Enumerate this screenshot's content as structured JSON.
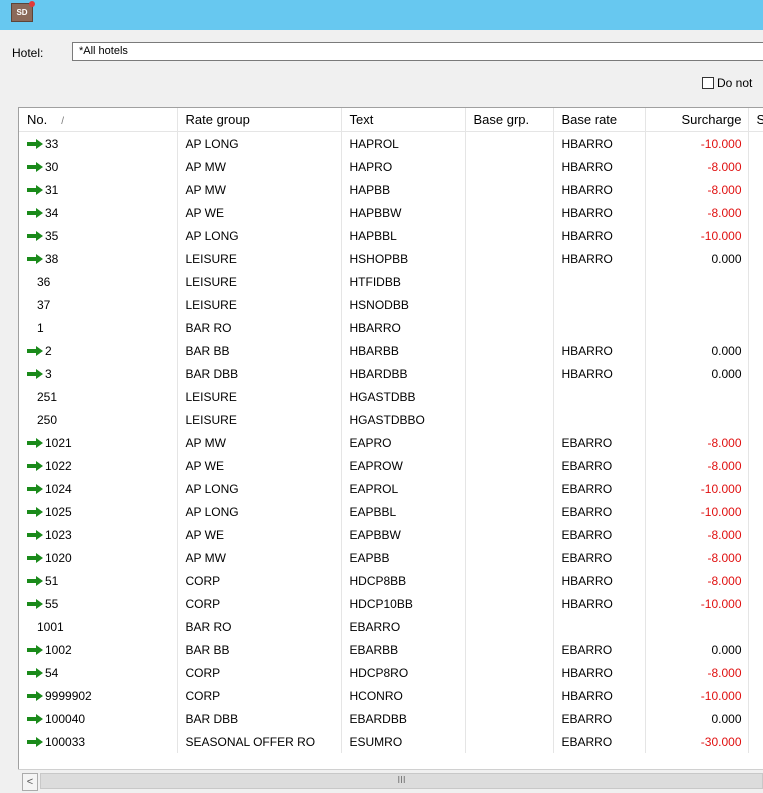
{
  "window": {
    "icon_text": "SD"
  },
  "filter": {
    "hotel_label": "Hotel:",
    "hotel_value": "*All hotels",
    "donot_label": "Do not"
  },
  "columns": [
    "No.",
    "Rate group",
    "Text",
    "Base grp.",
    "Base rate",
    "Surcharge",
    "Su"
  ],
  "rows": [
    {
      "arrow": true,
      "no": "33",
      "rate_group": "AP LONG",
      "text": "HAPROL",
      "base_grp": "",
      "base_rate": "HBARRO",
      "surcharge": "-10.000"
    },
    {
      "arrow": true,
      "no": "30",
      "rate_group": "AP MW",
      "text": "HAPRO",
      "base_grp": "",
      "base_rate": "HBARRO",
      "surcharge": "-8.000"
    },
    {
      "arrow": true,
      "no": "31",
      "rate_group": "AP MW",
      "text": "HAPBB",
      "base_grp": "",
      "base_rate": "HBARRO",
      "surcharge": "-8.000"
    },
    {
      "arrow": true,
      "no": "34",
      "rate_group": "AP WE",
      "text": "HAPBBW",
      "base_grp": "",
      "base_rate": "HBARRO",
      "surcharge": "-8.000"
    },
    {
      "arrow": true,
      "no": "35",
      "rate_group": "AP LONG",
      "text": "HAPBBL",
      "base_grp": "",
      "base_rate": "HBARRO",
      "surcharge": "-10.000"
    },
    {
      "arrow": true,
      "no": "38",
      "rate_group": "LEISURE",
      "text": "HSHOPBB",
      "base_grp": "",
      "base_rate": "HBARRO",
      "surcharge": "0.000"
    },
    {
      "arrow": false,
      "no": "36",
      "rate_group": "LEISURE",
      "text": "HTFIDBB",
      "base_grp": "",
      "base_rate": "",
      "surcharge": ""
    },
    {
      "arrow": false,
      "no": "37",
      "rate_group": "LEISURE",
      "text": "HSNODBB",
      "base_grp": "",
      "base_rate": "",
      "surcharge": ""
    },
    {
      "arrow": false,
      "no": "1",
      "rate_group": "BAR RO",
      "text": "HBARRO",
      "base_grp": "",
      "base_rate": "",
      "surcharge": ""
    },
    {
      "arrow": true,
      "no": "2",
      "rate_group": "BAR BB",
      "text": "HBARBB",
      "base_grp": "",
      "base_rate": "HBARRO",
      "surcharge": "0.000"
    },
    {
      "arrow": true,
      "no": "3",
      "rate_group": "BAR DBB",
      "text": "HBARDBB",
      "base_grp": "",
      "base_rate": "HBARRO",
      "surcharge": "0.000"
    },
    {
      "arrow": false,
      "no": "251",
      "rate_group": "LEISURE",
      "text": "HGASTDBB",
      "base_grp": "",
      "base_rate": "",
      "surcharge": ""
    },
    {
      "arrow": false,
      "no": "250",
      "rate_group": "LEISURE",
      "text": "HGASTDBBO",
      "base_grp": "",
      "base_rate": "",
      "surcharge": ""
    },
    {
      "arrow": true,
      "no": "1021",
      "rate_group": "AP MW",
      "text": "EAPRO",
      "base_grp": "",
      "base_rate": "EBARRO",
      "surcharge": "-8.000"
    },
    {
      "arrow": true,
      "no": "1022",
      "rate_group": "AP WE",
      "text": "EAPROW",
      "base_grp": "",
      "base_rate": "EBARRO",
      "surcharge": "-8.000"
    },
    {
      "arrow": true,
      "no": "1024",
      "rate_group": "AP LONG",
      "text": "EAPROL",
      "base_grp": "",
      "base_rate": "EBARRO",
      "surcharge": "-10.000"
    },
    {
      "arrow": true,
      "no": "1025",
      "rate_group": "AP LONG",
      "text": "EAPBBL",
      "base_grp": "",
      "base_rate": "EBARRO",
      "surcharge": "-10.000"
    },
    {
      "arrow": true,
      "no": "1023",
      "rate_group": "AP WE",
      "text": "EAPBBW",
      "base_grp": "",
      "base_rate": "EBARRO",
      "surcharge": "-8.000"
    },
    {
      "arrow": true,
      "no": "1020",
      "rate_group": "AP MW",
      "text": "EAPBB",
      "base_grp": "",
      "base_rate": "EBARRO",
      "surcharge": "-8.000"
    },
    {
      "arrow": true,
      "no": "51",
      "rate_group": "CORP",
      "text": "HDCP8BB",
      "base_grp": "",
      "base_rate": "HBARRO",
      "surcharge": "-8.000"
    },
    {
      "arrow": true,
      "no": "55",
      "rate_group": "CORP",
      "text": "HDCP10BB",
      "base_grp": "",
      "base_rate": "HBARRO",
      "surcharge": "-10.000"
    },
    {
      "arrow": false,
      "no": "1001",
      "rate_group": "BAR RO",
      "text": "EBARRO",
      "base_grp": "",
      "base_rate": "",
      "surcharge": ""
    },
    {
      "arrow": true,
      "no": "1002",
      "rate_group": "BAR BB",
      "text": "EBARBB",
      "base_grp": "",
      "base_rate": "EBARRO",
      "surcharge": "0.000"
    },
    {
      "arrow": true,
      "no": "54",
      "rate_group": "CORP",
      "text": "HDCP8RO",
      "base_grp": "",
      "base_rate": "HBARRO",
      "surcharge": "-8.000"
    },
    {
      "arrow": true,
      "no": "9999902",
      "rate_group": "CORP",
      "text": "HCONRO",
      "base_grp": "",
      "base_rate": "HBARRO",
      "surcharge": "-10.000"
    },
    {
      "arrow": true,
      "no": "100040",
      "rate_group": "BAR DBB",
      "text": "EBARDBB",
      "base_grp": "",
      "base_rate": "EBARRO",
      "surcharge": "0.000"
    },
    {
      "arrow": true,
      "no": "100033",
      "rate_group": "SEASONAL OFFER RO",
      "text": "ESUMRO",
      "base_grp": "",
      "base_rate": "EBARRO",
      "surcharge": "-30.000"
    }
  ],
  "colors": {
    "titlebar": "#67c8f0",
    "negative": "#e01010",
    "arrow": "#1a8a1a"
  },
  "scrollbar": {
    "left_arrow": "<",
    "thumb_grip": "III"
  }
}
